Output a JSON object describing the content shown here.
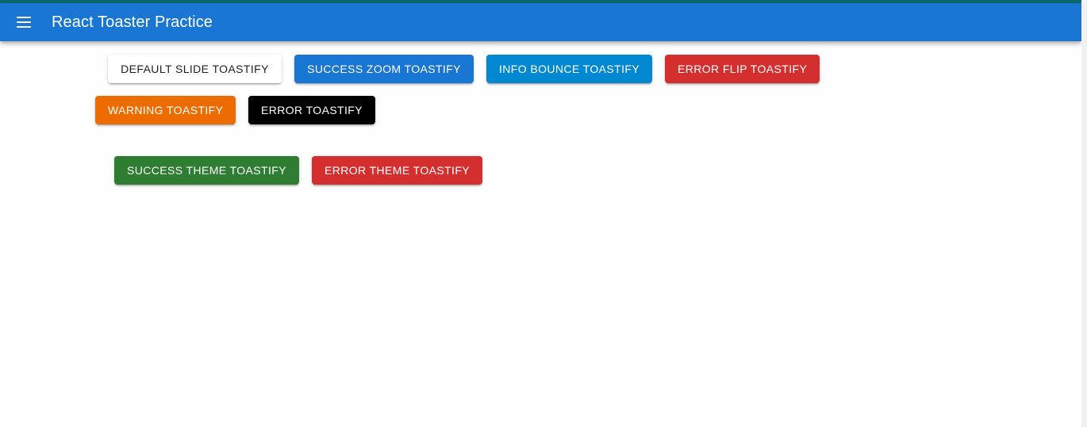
{
  "appbar": {
    "title": "React Toaster Practice",
    "menu_icon": "hamburger-menu-icon",
    "color": "#1976d2"
  },
  "buttons": {
    "row1": [
      {
        "label": "DEFAULT SLIDE TOASTIFY",
        "color": "#ffffff"
      },
      {
        "label": "SUCCESS ZOOM TOASTIFY",
        "color": "#1976d2"
      },
      {
        "label": "INFO BOUNCE TOASTIFY",
        "color": "#0288d1"
      },
      {
        "label": "ERROR FLIP TOASTIFY",
        "color": "#d32f2f"
      }
    ],
    "row2": [
      {
        "label": "WARNING TOASTIFY",
        "color": "#ed6c02"
      },
      {
        "label": "ERROR TOASTIFY",
        "color": "#000000"
      }
    ],
    "row3": [
      {
        "label": "SUCCESS THEME TOASTIFY",
        "color": "#2e7d32"
      },
      {
        "label": "ERROR THEME TOASTIFY",
        "color": "#d32f2f"
      }
    ]
  }
}
